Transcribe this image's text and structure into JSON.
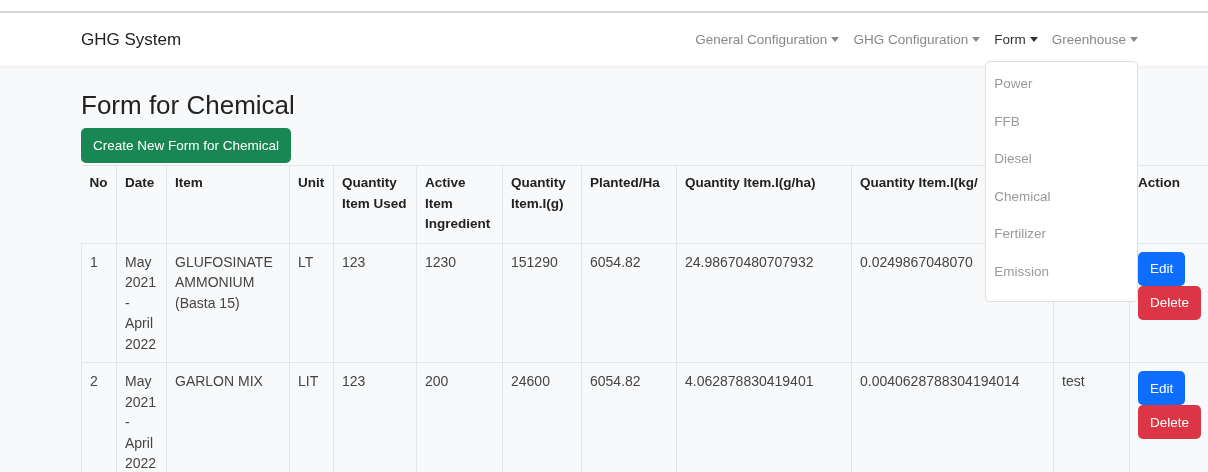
{
  "navbar": {
    "brand": "GHG System",
    "menus": [
      {
        "label": "General Configuration",
        "selected": false
      },
      {
        "label": "GHG Configuration",
        "selected": false
      },
      {
        "label": "Form",
        "selected": true
      },
      {
        "label": "Greenhouse",
        "selected": false
      }
    ]
  },
  "dropdown": {
    "items": [
      "Power",
      "FFB",
      "Diesel",
      "Chemical",
      "Fertilizer",
      "Emission"
    ]
  },
  "page": {
    "title": "Form for Chemical",
    "create_button": "Create New Form for Chemical"
  },
  "table": {
    "columns": [
      {
        "label": "No"
      },
      {
        "label": "Date"
      },
      {
        "label": "Item"
      },
      {
        "label": "Unit"
      },
      {
        "label": "Quantity Item Used"
      },
      {
        "label": "Active Item Ingredient"
      },
      {
        "label": "Quantity Item.I(g)"
      },
      {
        "label": "Planted/Ha"
      },
      {
        "label": "Quantity Item.I(g/ha)"
      },
      {
        "label": "Quantity Item.I(kg/"
      },
      {},
      {
        "label": "Action"
      }
    ],
    "rows": [
      {
        "cells": [
          "1",
          "May 2021 - April 2022",
          "GLUFOSINATE AMMONIUM (Basta 15)",
          "LT",
          "123",
          "1230",
          "151290",
          "6054.82",
          "24.98670480707932",
          "0.0249867048070",
          null
        ],
        "actions": [
          "Edit",
          "Delete"
        ]
      },
      {
        "cells": [
          "2",
          "May 2021 - April 2022",
          "GARLON MIX",
          "LIT",
          "123",
          "200",
          "24600",
          "6054.82",
          "4.062878830419401",
          "0.0040628788304194014",
          "test"
        ],
        "actions": [
          "Edit",
          "Delete"
        ]
      }
    ]
  }
}
